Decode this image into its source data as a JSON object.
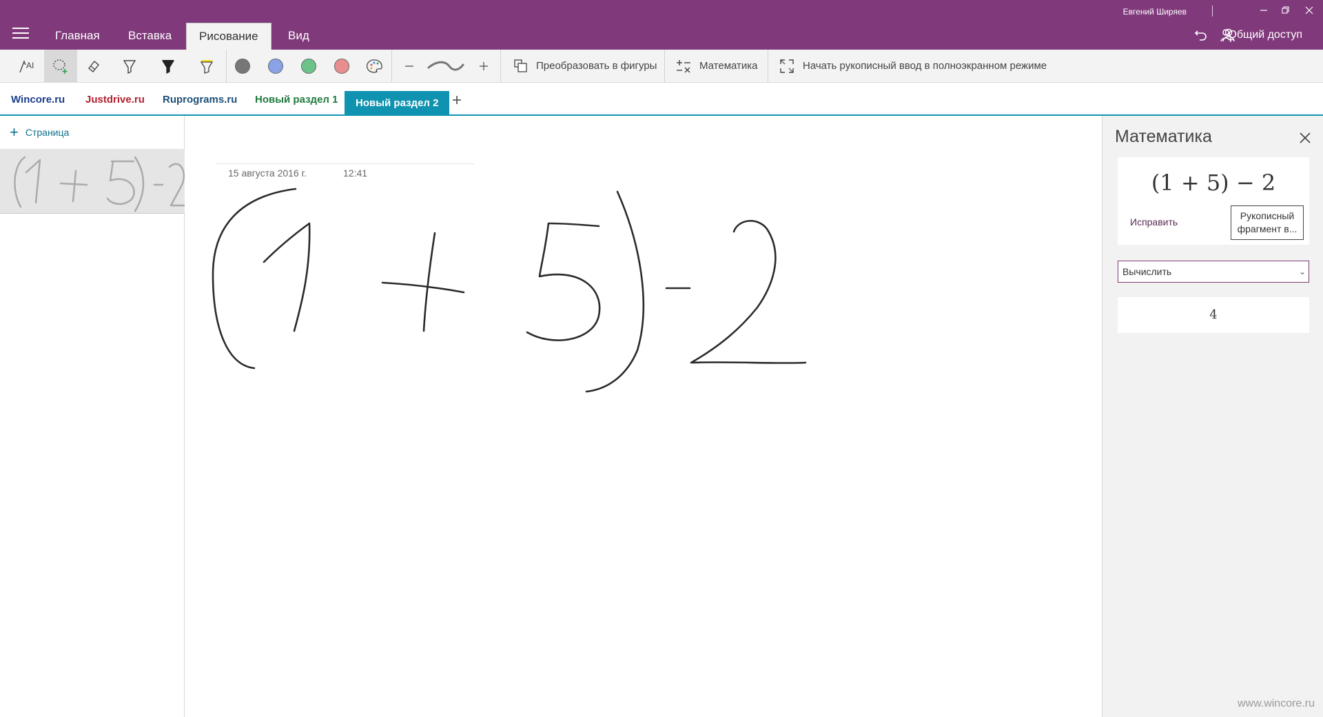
{
  "ribbon": {
    "tabs": [
      {
        "label": "Главная"
      },
      {
        "label": "Вставка"
      },
      {
        "label": "Рисование"
      },
      {
        "label": "Вид"
      }
    ],
    "user_name": "Евгений Ширяев",
    "share_label": "Общий доступ"
  },
  "toolbar": {
    "convert_label": "Преобразовать в фигуры",
    "math_label": "Математика",
    "fullscreen_label": "Начать рукописный ввод в полноэкранном режиме",
    "swatch_colors": [
      "#777777",
      "#8aa2e6",
      "#6cc38a",
      "#e88e8e"
    ]
  },
  "sections": [
    {
      "label": "Wincore.ru",
      "color": "#1a3e8a"
    },
    {
      "label": "Justdrive.ru",
      "color": "#b0212e"
    },
    {
      "label": "Ruprograms.ru",
      "color": "#1e4f7a"
    },
    {
      "label": "Новый раздел 1",
      "color": "#1f7a3c"
    },
    {
      "label": "Новый раздел 2",
      "color": "#ffffff"
    }
  ],
  "pagelist": {
    "add_page_label": "Страница"
  },
  "page": {
    "date": "15 августа 2016 г.",
    "time": "12:41"
  },
  "math": {
    "title": "Математика",
    "expression": "(1 + 5) − 2",
    "fix_label": "Исправить",
    "ink_button_label": "Рукописный фрагмент в...",
    "action_selected": "Вычислить",
    "result": "4"
  },
  "watermark": "www.wincore.ru"
}
